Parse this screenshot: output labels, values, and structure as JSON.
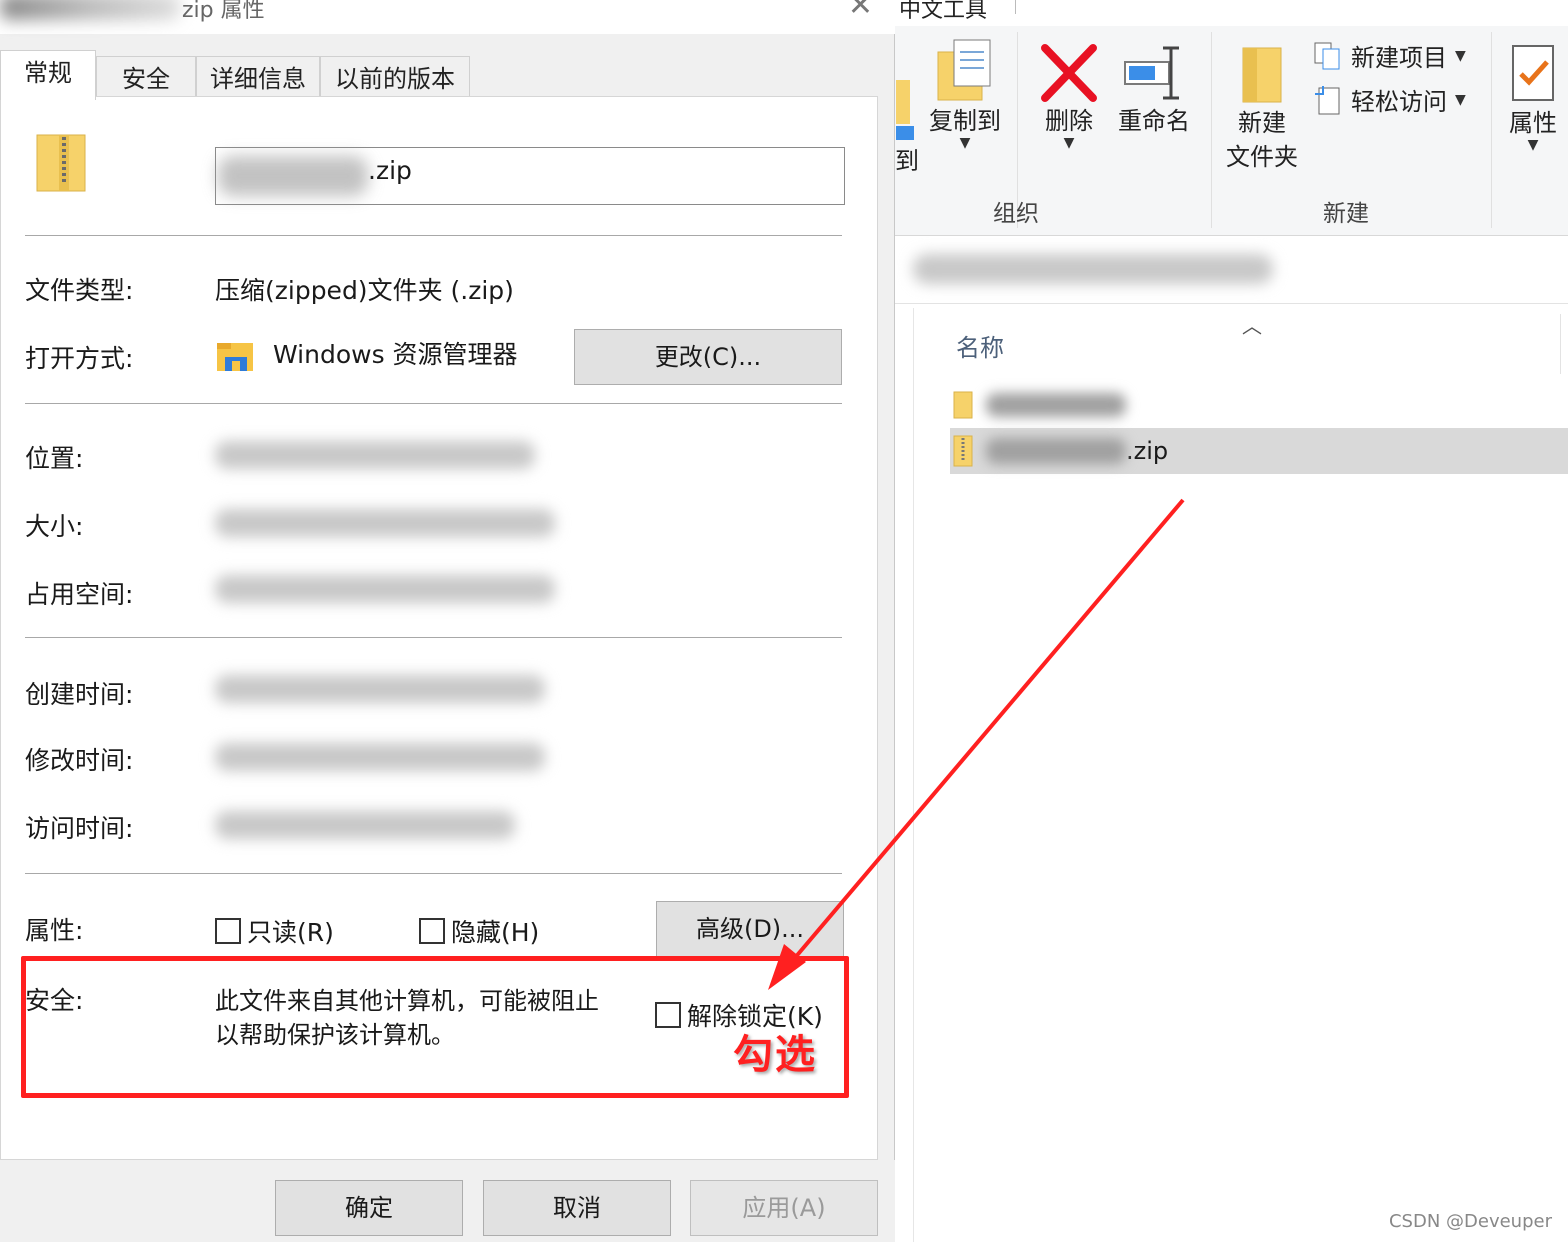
{
  "explorer": {
    "title": "中文工具",
    "ribbon": {
      "move_to_partial": "到",
      "copy_to": "复制到",
      "delete": "删除",
      "rename": "重命名",
      "new_folder_line1": "新建",
      "new_folder_line2": "文件夹",
      "new_item": "新建项目",
      "easy_access": "轻松访问",
      "properties": "属性",
      "group_organize": "组织",
      "group_new": "新建"
    },
    "column_name": "名称",
    "files": [
      {
        "name_suffix": "",
        "type": "folder",
        "selected": false
      },
      {
        "name_suffix": ".zip",
        "type": "zip",
        "selected": true
      }
    ]
  },
  "dialog": {
    "title_suffix": "zip 属性",
    "tabs": [
      "常规",
      "安全",
      "详细信息",
      "以前的版本"
    ],
    "active_tab": "常规",
    "filename_ext": ".zip",
    "file_type_label": "文件类型:",
    "file_type_value": "压缩(zipped)文件夹 (.zip)",
    "open_with_label": "打开方式:",
    "open_with_value": "Windows 资源管理器",
    "change_button": "更改(C)...",
    "location_label": "位置:",
    "size_label": "大小:",
    "size_on_disk_label": "占用空间:",
    "created_label": "创建时间:",
    "modified_label": "修改时间:",
    "accessed_label": "访问时间:",
    "attributes_label": "属性:",
    "readonly": "只读(R)",
    "hidden": "隐藏(H)",
    "advanced_button": "高级(D)...",
    "security_label": "安全:",
    "security_text_line1": "此文件来自其他计算机，可能被阻止",
    "security_text_line2": "以帮助保护该计算机。",
    "unblock": "解除锁定(K)",
    "ok_button": "确定",
    "cancel_button": "取消",
    "apply_button": "应用(A)"
  },
  "annotation": {
    "label": "勾选",
    "color": "#ff2020"
  },
  "watermark": "CSDN @Deveuper"
}
